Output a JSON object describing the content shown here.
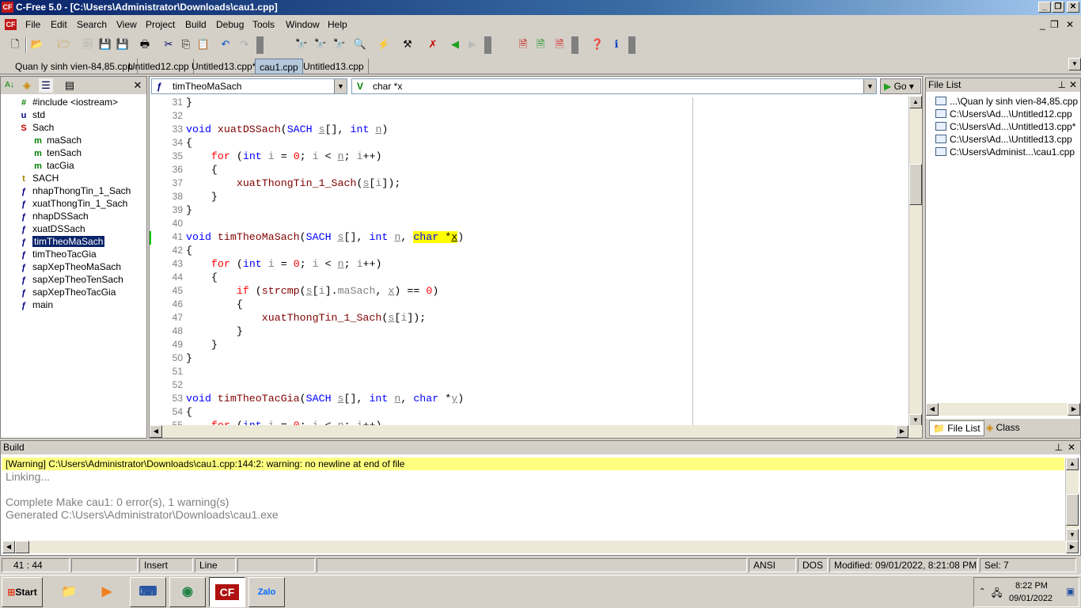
{
  "window": {
    "title": "C-Free 5.0 - [C:\\Users\\Administrator\\Downloads\\cau1.cpp]",
    "app_icon": "CF"
  },
  "menu": [
    "File",
    "Edit",
    "Search",
    "View",
    "Project",
    "Build",
    "Debug",
    "Tools",
    "Window",
    "Help"
  ],
  "tabs": [
    {
      "label": "Quan ly sinh vien-84,85.cpp"
    },
    {
      "label": "Untitled12.cpp"
    },
    {
      "label": "Untitled13.cpp*"
    },
    {
      "label": "cau1.cpp",
      "active": true
    },
    {
      "label": "Untitled13.cpp"
    }
  ],
  "tree": [
    {
      "icon": "#",
      "label": "#include <iostream>",
      "level": 1,
      "color": "#008000"
    },
    {
      "icon": "u",
      "label": "std",
      "level": 1,
      "color": "#000080"
    },
    {
      "icon": "S",
      "label": "Sach",
      "level": 1,
      "color": "#c00000"
    },
    {
      "icon": "m",
      "label": "maSach",
      "level": 2,
      "color": "#008000"
    },
    {
      "icon": "m",
      "label": "tenSach",
      "level": 2,
      "color": "#008000"
    },
    {
      "icon": "m",
      "label": "tacGia",
      "level": 2,
      "color": "#008000"
    },
    {
      "icon": "t",
      "label": "SACH",
      "level": 1,
      "color": "#a08000"
    },
    {
      "icon": "f",
      "label": "nhapThongTin_1_Sach",
      "level": 1,
      "color": "#000080"
    },
    {
      "icon": "f",
      "label": "xuatThongTin_1_Sach",
      "level": 1,
      "color": "#000080"
    },
    {
      "icon": "f",
      "label": "nhapDSSach",
      "level": 1,
      "color": "#000080"
    },
    {
      "icon": "f",
      "label": "xuatDSSach",
      "level": 1,
      "color": "#000080"
    },
    {
      "icon": "f",
      "label": "timTheoMaSach",
      "level": 1,
      "color": "#000080",
      "selected": true
    },
    {
      "icon": "f",
      "label": "timTheoTacGia",
      "level": 1,
      "color": "#000080"
    },
    {
      "icon": "f",
      "label": "sapXepTheoMaSach",
      "level": 1,
      "color": "#000080"
    },
    {
      "icon": "f",
      "label": "sapXepTheoTenSach",
      "level": 1,
      "color": "#000080"
    },
    {
      "icon": "f",
      "label": "sapXepTheoTacGia",
      "level": 1,
      "color": "#000080"
    },
    {
      "icon": "f",
      "label": "main",
      "level": 1,
      "color": "#000080"
    }
  ],
  "editor": {
    "function_combo": "timTheoMaSach",
    "variable_combo": "char *x",
    "go_label": "Go",
    "lines": [
      {
        "n": "31",
        "t": [
          [
            "pl",
            "}"
          ]
        ]
      },
      {
        "n": "32",
        "t": []
      },
      {
        "n": "33",
        "t": [
          [
            "kw",
            "void"
          ],
          [
            "pl",
            " "
          ],
          [
            "fn",
            "xuatDSSach"
          ],
          [
            "pl",
            "("
          ],
          [
            "kw",
            "SACH"
          ],
          [
            "pl",
            " "
          ],
          [
            "va",
            "s"
          ],
          [
            "pl",
            "[], "
          ],
          [
            "kw",
            "int"
          ],
          [
            "pl",
            " "
          ],
          [
            "va",
            "n"
          ],
          [
            "pl",
            ")"
          ]
        ]
      },
      {
        "n": "34",
        "t": [
          [
            "pl",
            "{"
          ]
        ]
      },
      {
        "n": "35",
        "t": [
          [
            "pl",
            "    "
          ],
          [
            "ct",
            "for"
          ],
          [
            "pl",
            " ("
          ],
          [
            "kw",
            "int"
          ],
          [
            "gr",
            " i "
          ],
          [
            "pl",
            "= "
          ],
          [
            "nm",
            "0"
          ],
          [
            "pl",
            "; "
          ],
          [
            "gr",
            "i"
          ],
          [
            "pl",
            " < "
          ],
          [
            "va",
            "n"
          ],
          [
            "pl",
            "; "
          ],
          [
            "gr",
            "i"
          ],
          [
            "pl",
            "++)"
          ]
        ]
      },
      {
        "n": "36",
        "t": [
          [
            "pl",
            "    {"
          ]
        ]
      },
      {
        "n": "37",
        "t": [
          [
            "pl",
            "        "
          ],
          [
            "fn",
            "xuatThongTin_1_Sach"
          ],
          [
            "pl",
            "("
          ],
          [
            "va",
            "s"
          ],
          [
            "pl",
            "["
          ],
          [
            "gr",
            "i"
          ],
          [
            "pl",
            "]);"
          ]
        ]
      },
      {
        "n": "38",
        "t": [
          [
            "pl",
            "    }"
          ]
        ]
      },
      {
        "n": "39",
        "t": [
          [
            "pl",
            "}"
          ]
        ]
      },
      {
        "n": "40",
        "t": []
      },
      {
        "n": "41",
        "t": [
          [
            "kw",
            "void"
          ],
          [
            "pl",
            " "
          ],
          [
            "fn",
            "timTheoMaSach"
          ],
          [
            "pl",
            "("
          ],
          [
            "kw",
            "SACH"
          ],
          [
            "pl",
            " "
          ],
          [
            "va",
            "s"
          ],
          [
            "pl",
            "[], "
          ],
          [
            "kw",
            "int"
          ],
          [
            "pl",
            " "
          ],
          [
            "va",
            "n"
          ],
          [
            "pl",
            ", "
          ],
          [
            "kw hl",
            "char"
          ],
          [
            "pl hl",
            " *"
          ],
          [
            "va hl",
            "x"
          ],
          [
            "pl",
            ")"
          ]
        ],
        "current": true
      },
      {
        "n": "42",
        "t": [
          [
            "pl",
            "{"
          ]
        ]
      },
      {
        "n": "43",
        "t": [
          [
            "pl",
            "    "
          ],
          [
            "ct",
            "for"
          ],
          [
            "pl",
            " ("
          ],
          [
            "kw",
            "int"
          ],
          [
            "gr",
            " i "
          ],
          [
            "pl",
            "= "
          ],
          [
            "nm",
            "0"
          ],
          [
            "pl",
            "; "
          ],
          [
            "gr",
            "i"
          ],
          [
            "pl",
            " < "
          ],
          [
            "va",
            "n"
          ],
          [
            "pl",
            "; "
          ],
          [
            "gr",
            "i"
          ],
          [
            "pl",
            "++)"
          ]
        ]
      },
      {
        "n": "44",
        "t": [
          [
            "pl",
            "    {"
          ]
        ]
      },
      {
        "n": "45",
        "t": [
          [
            "pl",
            "        "
          ],
          [
            "ct",
            "if"
          ],
          [
            "pl",
            " ("
          ],
          [
            "fn",
            "strcmp"
          ],
          [
            "pl",
            "("
          ],
          [
            "va",
            "s"
          ],
          [
            "pl",
            "["
          ],
          [
            "gr",
            "i"
          ],
          [
            "pl",
            "]."
          ],
          [
            "gr",
            "maSach"
          ],
          [
            "pl",
            ", "
          ],
          [
            "va",
            "x"
          ],
          [
            "pl",
            ") == "
          ],
          [
            "nm",
            "0"
          ],
          [
            "pl",
            ")"
          ]
        ]
      },
      {
        "n": "46",
        "t": [
          [
            "pl",
            "        {"
          ]
        ]
      },
      {
        "n": "47",
        "t": [
          [
            "pl",
            "            "
          ],
          [
            "fn",
            "xuatThongTin_1_Sach"
          ],
          [
            "pl",
            "("
          ],
          [
            "va",
            "s"
          ],
          [
            "pl",
            "["
          ],
          [
            "gr",
            "i"
          ],
          [
            "pl",
            "]);"
          ]
        ]
      },
      {
        "n": "48",
        "t": [
          [
            "pl",
            "        }"
          ]
        ]
      },
      {
        "n": "49",
        "t": [
          [
            "pl",
            "    }"
          ]
        ]
      },
      {
        "n": "50",
        "t": [
          [
            "pl",
            "}"
          ]
        ]
      },
      {
        "n": "51",
        "t": []
      },
      {
        "n": "52",
        "t": []
      },
      {
        "n": "53",
        "t": [
          [
            "kw",
            "void"
          ],
          [
            "pl",
            " "
          ],
          [
            "fn",
            "timTheoTacGia"
          ],
          [
            "pl",
            "("
          ],
          [
            "kw",
            "SACH"
          ],
          [
            "pl",
            " "
          ],
          [
            "va",
            "s"
          ],
          [
            "pl",
            "[], "
          ],
          [
            "kw",
            "int"
          ],
          [
            "pl",
            " "
          ],
          [
            "va",
            "n"
          ],
          [
            "pl",
            ", "
          ],
          [
            "kw",
            "char"
          ],
          [
            "pl",
            " *"
          ],
          [
            "va",
            "y"
          ],
          [
            "pl",
            ")"
          ]
        ]
      },
      {
        "n": "54",
        "t": [
          [
            "pl",
            "{"
          ]
        ]
      },
      {
        "n": "55",
        "t": [
          [
            "pl",
            "    "
          ],
          [
            "ct",
            "for"
          ],
          [
            "pl",
            " ("
          ],
          [
            "kw",
            "int"
          ],
          [
            "gr",
            " i "
          ],
          [
            "pl",
            "= "
          ],
          [
            "nm",
            "0"
          ],
          [
            "pl",
            "; "
          ],
          [
            "gr",
            "i"
          ],
          [
            "pl",
            " < "
          ],
          [
            "va",
            "n"
          ],
          [
            "pl",
            "; "
          ],
          [
            "gr",
            "i"
          ],
          [
            "pl",
            "++)"
          ]
        ]
      }
    ]
  },
  "filelist": {
    "title": "File List",
    "items": [
      "...\\Quan ly sinh vien-84,85.cpp",
      "C:\\Users\\Ad...\\Untitled12.cpp",
      "C:\\Users\\Ad...\\Untitled13.cpp*",
      "C:\\Users\\Ad...\\Untitled13.cpp",
      "C:\\Users\\Administ...\\cau1.cpp"
    ],
    "tabs": [
      "File List",
      "Class"
    ]
  },
  "build": {
    "title": "Build",
    "warning": "[Warning] C:\\Users\\Administrator\\Downloads\\cau1.cpp:144:2: warning: no newline at end of file",
    "lines": [
      "Linking...",
      "",
      "Complete Make cau1: 0 error(s), 1 warning(s)",
      "Generated C:\\Users\\Administrator\\Downloads\\cau1.exe"
    ]
  },
  "status": {
    "position": "41 : 44",
    "mode": "Insert",
    "line": "Line",
    "encoding": "ANSI",
    "eol": "DOS",
    "modified": "Modified: 09/01/2022, 8:21:08 PM",
    "sel": "Sel: 7"
  },
  "taskbar": {
    "start": "Start",
    "apps": [
      "file-explorer",
      "media-player",
      "keyboard-app",
      "chrome",
      "c-free",
      "zalo"
    ],
    "time": "8:22 PM",
    "date": "09/01/2022"
  },
  "colors": {
    "highlight": "#ffff00",
    "keyword": "#0000ff",
    "function": "#800000",
    "warning_bg": "#ffff80",
    "title_bar": "#0a246a"
  }
}
